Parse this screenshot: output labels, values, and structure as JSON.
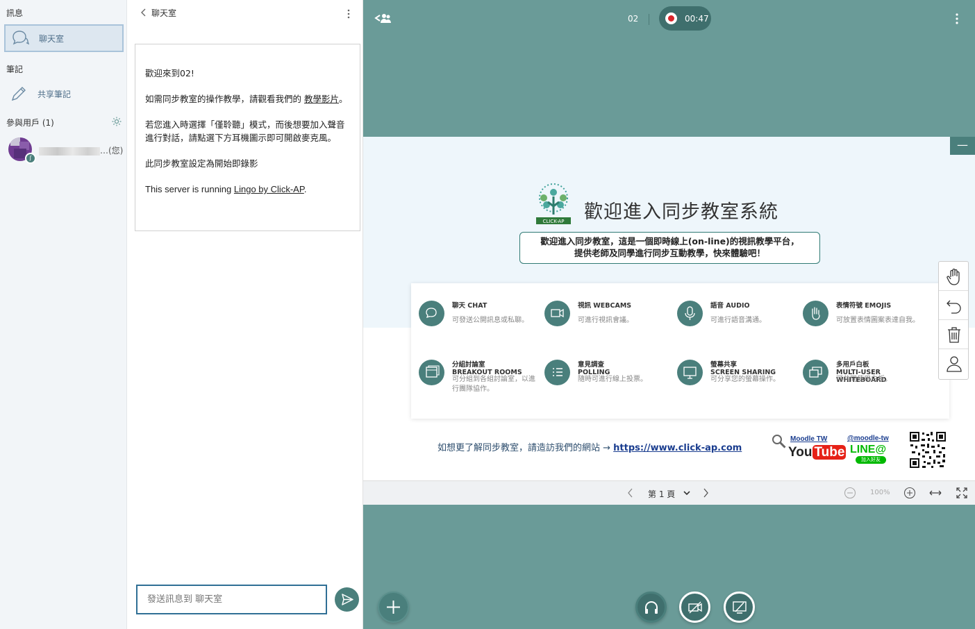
{
  "sidebar": {
    "messages_title": "訊息",
    "chat_item": "聊天室",
    "notes_title": "筆記",
    "shared_notes_item": "共享筆記",
    "users_title": "參與用戶 (1)",
    "user_name_suffix": "…(您)"
  },
  "chat": {
    "title": "聊天室",
    "welcome_line1": "歡迎來到02!",
    "tutorial_prefix": "如需同步教室的操作教學，請觀看我們的 ",
    "tutorial_link": "教學影片",
    "tutorial_suffix": "。",
    "listen_only": "若您進入時選擇「僅聆聽」模式，而後想要加入聲音進行對話，請點選下方耳機圖示即可開啟麥克風。",
    "recording_notice": "此同步教室設定為開始即錄影",
    "server_prefix": "This server is running ",
    "server_link": "Lingo by Click-AP",
    "server_suffix": ".",
    "input_placeholder": "發送訊息到 聊天室"
  },
  "topbar": {
    "conference_name": "02",
    "recording_time": "00:47"
  },
  "slide": {
    "logo_text": "CLICK-AP",
    "title": "歡迎進入同步教室系統",
    "intro_line1": "歡迎進入同步教室，這是一個即時線上(on-line)的視訊教學平台，",
    "intro_line2": "提供老師及同學進行同步互動教學，快來體驗吧！",
    "features": [
      {
        "title": "聊天 CHAT",
        "desc": "可發送公開訊息或私聊。",
        "icon": "chat-icon"
      },
      {
        "title": "視訊 WEBCAMS",
        "desc": "可進行視訊會議。",
        "icon": "video-camera-icon"
      },
      {
        "title": "語音 AUDIO",
        "desc": "可進行語音溝通。",
        "icon": "microphone-icon"
      },
      {
        "title": "表情符號 EMOJIS",
        "desc": "可放置表情圖案表達自我。",
        "icon": "hand-icon"
      },
      {
        "title_line1": "分組討論室",
        "title_line2": "BREAKOUT ROOMS",
        "desc": "可分組到各組討論室，以進行團隊協作。",
        "icon": "rooms-icon"
      },
      {
        "title_line1": "意見調查",
        "title_line2": "POLLING",
        "desc": "隨時可進行線上投票。",
        "icon": "list-icon"
      },
      {
        "title_line1": "螢幕共享",
        "title_line2": "SCREEN SHARING",
        "desc": "可分享您的螢幕操作。",
        "icon": "monitor-icon"
      },
      {
        "title_line1": "多用戶白板",
        "title_line2": "MULTI-USER WHITEBOARD",
        "desc": "可共同使用白板。",
        "icon": "whiteboard-icon"
      }
    ],
    "footer_text": "如想更了解同步教室，請造訪我們的網站 → ",
    "footer_link": "https://www.click-ap.com",
    "moodle_tw": "Moodle TW",
    "you": "You",
    "tube": "Tube",
    "line_handle": "@moodle-tw",
    "line_logo": "LINE@",
    "line_add": "加入好友"
  },
  "slide_toolbar": {
    "page_label": "第 1 頁",
    "zoom": "100%"
  },
  "colors": {
    "accent": "#4a7f7c",
    "main_bg": "#6a9b98",
    "record_red": "#d9252b"
  }
}
